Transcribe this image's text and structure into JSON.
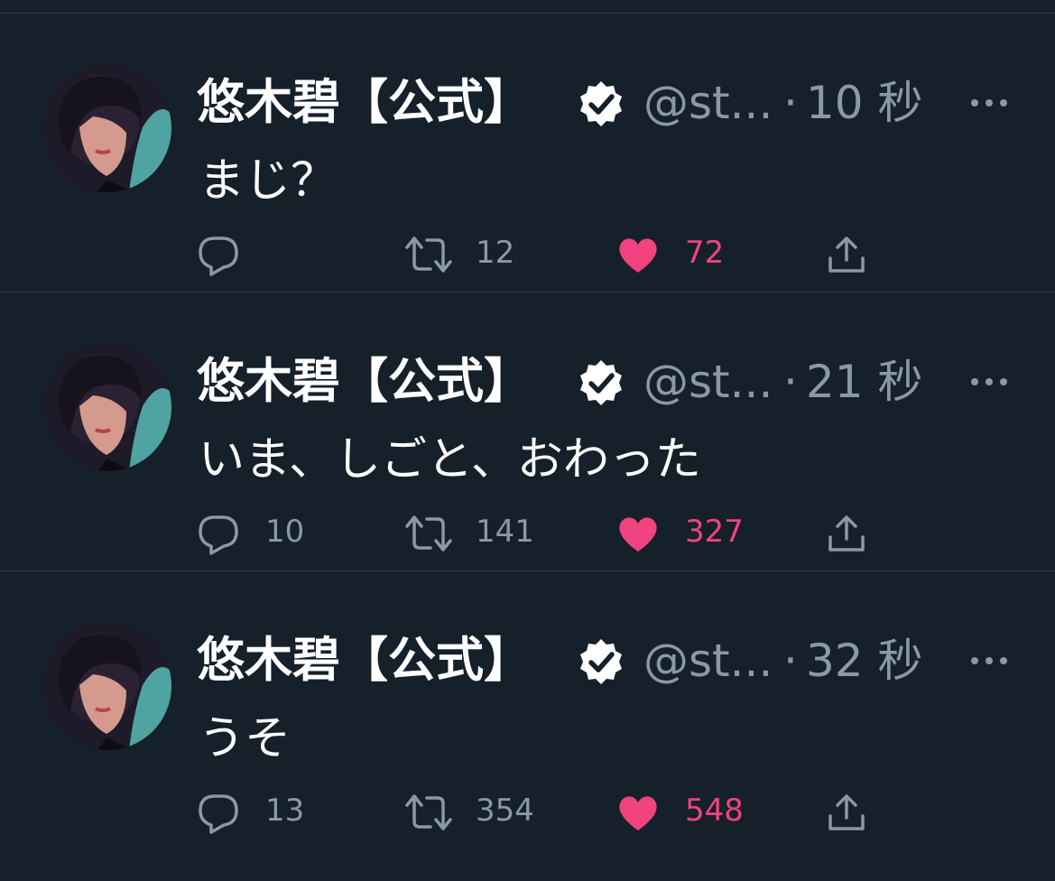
{
  "tweets": [
    {
      "name": "悠木碧【公式】",
      "handle": "@st...",
      "separator": "·",
      "time": "10 秒",
      "text": "まじ？",
      "replies": "",
      "retweets": "12",
      "likes": "72"
    },
    {
      "name": "悠木碧【公式】",
      "handle": "@st...",
      "separator": "·",
      "time": "21 秒",
      "text": "いま、しごと、おわった",
      "replies": "10",
      "retweets": "141",
      "likes": "327"
    },
    {
      "name": "悠木碧【公式】",
      "handle": "@st...",
      "separator": "·",
      "time": "32 秒",
      "text": "うそ",
      "replies": "13",
      "retweets": "354",
      "likes": "548"
    }
  ],
  "icons": {
    "verified": "verified-badge-icon",
    "more": "more-options-icon",
    "reply": "reply-icon",
    "retweet": "retweet-icon",
    "like": "heart-icon",
    "share": "share-icon"
  },
  "colors": {
    "background": "#15202b",
    "muted": "#8b98a5",
    "like_active": "#f0437f",
    "divider": "#2f3b47"
  }
}
